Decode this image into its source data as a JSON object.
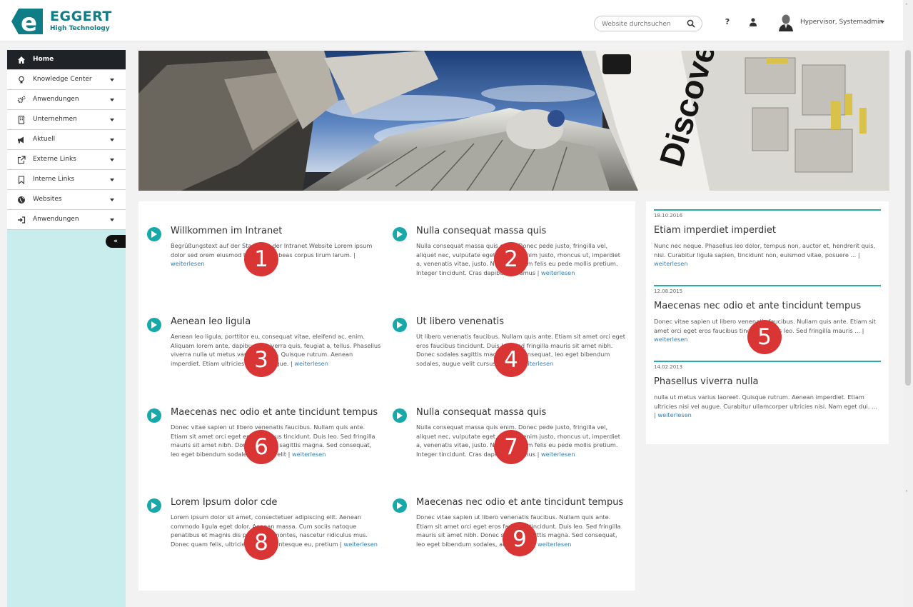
{
  "brand": {
    "name": "EGGERT",
    "tagline": "High Technology",
    "color": "#0f7d86"
  },
  "header": {
    "search_placeholder": "Website durchsuchen",
    "help_label": "?",
    "user_name": "Hypervisor, Systemadmin"
  },
  "sidebar": {
    "items": [
      {
        "label": "Home",
        "icon": "home-icon",
        "active": true,
        "has_caret": false
      },
      {
        "label": "Knowledge Center",
        "icon": "lightbulb-icon",
        "has_caret": true
      },
      {
        "label": "Anwendungen",
        "icon": "gears-icon",
        "has_caret": true
      },
      {
        "label": "Unternehmen",
        "icon": "building-icon",
        "has_caret": true
      },
      {
        "label": "Aktuell",
        "icon": "megaphone-icon",
        "has_caret": true
      },
      {
        "label": "Externe Links",
        "icon": "external-link-icon",
        "has_caret": true
      },
      {
        "label": "Interne Links",
        "icon": "bookmark-icon",
        "has_caret": true
      },
      {
        "label": "Websites",
        "icon": "globe-icon",
        "has_caret": true
      },
      {
        "label": "Anwendungen",
        "icon": "sign-in-icon",
        "has_caret": true
      }
    ],
    "collapse_label": "«"
  },
  "banner": {
    "text": "Discover"
  },
  "articles": [
    {
      "title": "Willkommen im Intranet",
      "text": "Begrüßungstext auf der Startseite der Intranet Website Lorem ipsum dolor sed orem eiusmod temporis habeas corpus lirum larum. | ",
      "link": "weiterlesen",
      "marker": "1"
    },
    {
      "title": "Nulla consequat massa quis",
      "text": "Nulla consequat massa quis enim. Donec pede justo, fringilla vel, aliquet nec, vulputate eget, arcu. In enim justo, rhoncus ut, imperdiet a, venenatis vitae, justo. Nullam dictum felis eu pede mollis pretium. Integer tincidunt. Cras dapibus. Vivamus | ",
      "link": "weiterlesen",
      "marker": "2"
    },
    {
      "title": "Aenean leo ligula",
      "text": "Aenean leo ligula, porttitor eu, consequat vitae, eleifend ac, enim. Aliquam lorem ante, dapibus in, viverra quis, feugiat a, tellus. Phasellus viverra nulla ut metus varius laoreet. Quisque rutrum. Aenean imperdiet. Etiam ultricies nisi vel augue. | ",
      "link": "weiterlesen",
      "marker": "3"
    },
    {
      "title": "Ut libero venenatis",
      "text": "Ut libero venenatis faucibus. Nullam quis ante. Etiam sit amet orci eget eros faucibus tincidunt. Duis leo. Sed fringilla mauris sit amet nibh. Donec sodales sagittis magna. Sed consequat, leo eget bibendum sodales, augue velit cursus nunc. | ",
      "link": "weiterlesen",
      "marker": "4"
    },
    {
      "title": "Maecenas nec odio et ante tincidunt tempus",
      "text": "Donec vitae sapien ut libero venenatis faucibus. Nullam quis ante. Etiam sit amet orci eget eros faucibus tincidunt. Duis leo. Sed fringilla mauris sit amet nibh. Donec sodales sagittis magna. Sed consequat, leo eget bibendum sodales, augue velit | ",
      "link": "weiterlesen",
      "marker": "6"
    },
    {
      "title": "Nulla consequat massa quis",
      "text": "Nulla consequat massa quis enim. Donec pede justo, fringilla vel, aliquet nec, vulputate eget, arcu. In enim justo, rhoncus ut, imperdiet a, venenatis vitae, justo. Nullam dictum felis eu pede mollis pretium. Integer tincidunt. Cras dapibus. Vivamus | ",
      "link": "weiterlesen",
      "marker": "7"
    },
    {
      "title": "Lorem Ipsum dolor cde",
      "text": "Lorem ipsum dolor sit amet, consectetuer adipiscing elit. Aenean commodo ligula eget dolor. Aenean massa. Cum sociis natoque penatibus et magnis dis parturient montes, nascetur ridiculus mus. Donec quam felis, ultricies nec, pellentesque eu, pretium | ",
      "link": "weiterlesen",
      "marker": "8"
    },
    {
      "title": "Maecenas nec odio et ante tincidunt tempus",
      "text": "Donec vitae sapien ut libero venenatis faucibus. Nullam quis ante. Etiam sit amet orci eget eros faucibus tincidunt. Duis leo. Sed fringilla mauris sit amet nibh. Donec sodales sagittis magna. Sed consequat, leo eget bibendum sodales, augue velit | ",
      "link": "weiterlesen",
      "marker": "9"
    }
  ],
  "news": {
    "marker": "5",
    "items": [
      {
        "date": "18.10.2016",
        "title": "Etiam imperdiet imperdiet",
        "text": "Nunc nec neque. Phasellus leo dolor, tempus non, auctor et, hendrerit quis, nisi. Curabitur ligula sapien, tincidunt non, euismod vitae, posuere ... | ",
        "link": "weiterlesen"
      },
      {
        "date": "12.08.2015",
        "title": "Maecenas nec odio et ante tincidunt tempus",
        "text": "Donec vitae sapien ut libero venenatis faucibus. Nullam quis ante. Etiam sit amet orci eget eros faucibus tincidunt. Duis leo. Sed fringilla mauris ... | ",
        "link": "weiterlesen"
      },
      {
        "date": "14.02.2013",
        "title": "Phasellus viverra nulla",
        "text": "nulla ut metus varius laoreet. Quisque rutrum. Aenean imperdiet. Etiam ultricies nisi vel augue. Curabitur ullamcorper ultricies nisi. Nam eget dui. ... | ",
        "link": "weiterlesen"
      }
    ]
  },
  "colors": {
    "accent": "#17a9a9",
    "marker": "#d93535",
    "sidebar_bg": "#c9ecec",
    "nav_active": "#1f2328",
    "link": "#2f7fb8"
  }
}
